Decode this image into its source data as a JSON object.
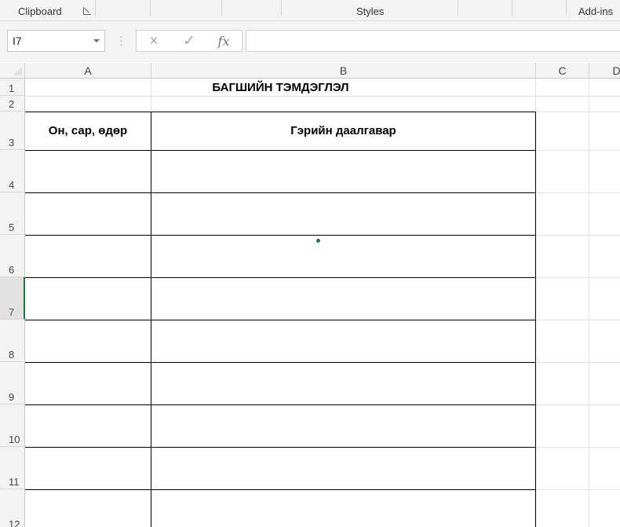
{
  "ribbon": {
    "groups": [
      "Clipboard",
      "Styles",
      "Add-ins"
    ]
  },
  "formula_bar": {
    "name_box": "I7",
    "cancel_icon": "×",
    "enter_icon": "✓",
    "function_icon": "fx",
    "formula": ""
  },
  "sheet": {
    "columns": [
      "A",
      "B",
      "C",
      "D"
    ],
    "rows": [
      "1",
      "2",
      "3",
      "4",
      "5",
      "6",
      "7",
      "8",
      "9",
      "10",
      "11",
      "12"
    ],
    "active_row": "7",
    "title": "БАГШИЙН ТЭМДЭГЛЭЛ",
    "table_headers": [
      "Он, сар, өдөр",
      "Гэрийн даалгавар"
    ]
  },
  "colors": {
    "accent": "#217346",
    "header_bg": "#f3f3f3",
    "gridline": "#e2e2e2",
    "border": "#000000"
  }
}
